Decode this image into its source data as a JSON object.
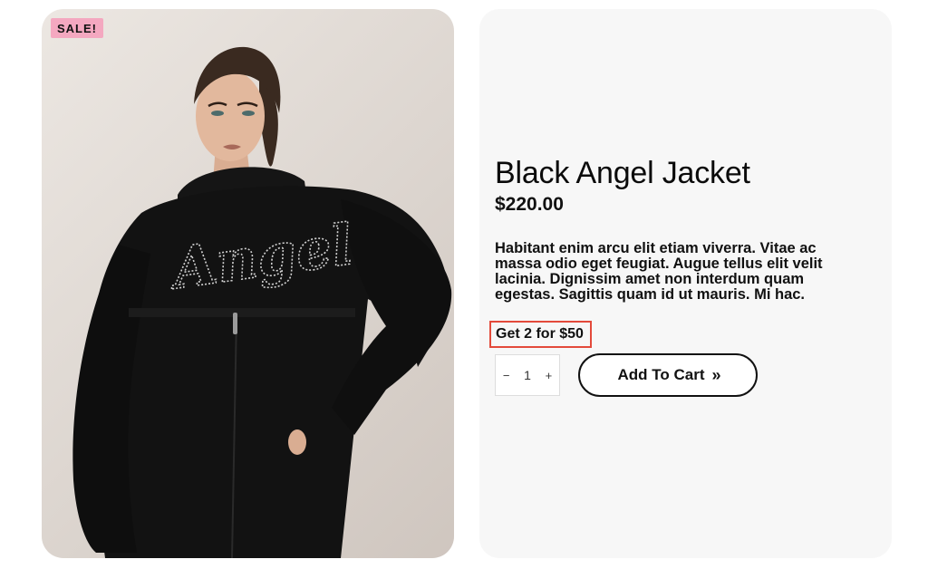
{
  "badge": {
    "text": "SALE!"
  },
  "product": {
    "title": "Black Angel Jacket",
    "price": "$220.00",
    "description": "Habitant enim arcu elit etiam viverra. Vitae ac massa odio eget feugiat. Augue tellus elit velit lacinia. Dignissim amet non interdum quam egestas. Sagittis quam id ut mauris. Mi hac.",
    "promo": "Get 2 for $50",
    "garment_print": "Angel"
  },
  "quantity": {
    "minus": "−",
    "value": "1",
    "plus": "+"
  },
  "cart": {
    "label": "Add To Cart",
    "icon": "double-chevron-right-icon",
    "icon_glyph": "»"
  },
  "colors": {
    "badge_bg": "#f4a8c0",
    "promo_border": "#e34a3b",
    "panel_bg": "#f7f7f7"
  }
}
